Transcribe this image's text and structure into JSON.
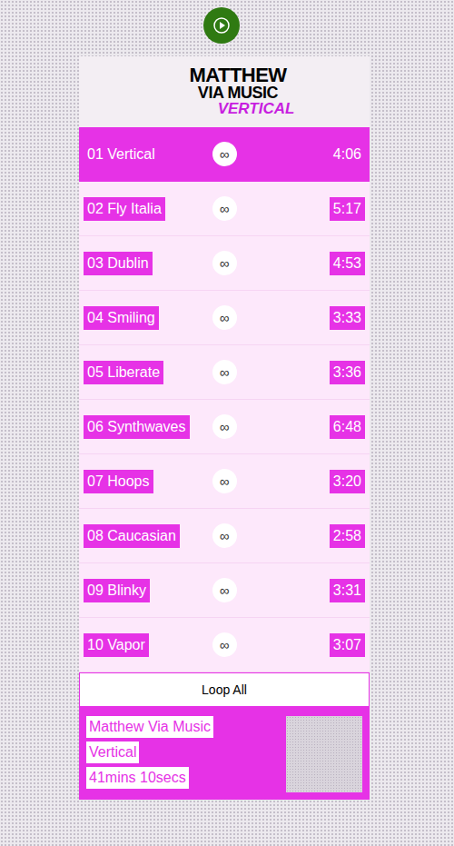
{
  "player": {
    "playing": false
  },
  "header": {
    "logo": [
      "MATTHEW",
      "VIA MUSIC",
      "VERTICAL"
    ]
  },
  "tracks": [
    {
      "title": "01 Vertical",
      "loop": "∞",
      "duration": "4:06",
      "selected": true
    },
    {
      "title": "02 Fly Italia",
      "loop": "∞",
      "duration": "5:17",
      "selected": false
    },
    {
      "title": "03 Dublin",
      "loop": "∞",
      "duration": "4:53",
      "selected": false
    },
    {
      "title": "04 Smiling",
      "loop": "∞",
      "duration": "3:33",
      "selected": false
    },
    {
      "title": "05 Liberate",
      "loop": "∞",
      "duration": "3:36",
      "selected": false
    },
    {
      "title": "06 Synthwaves",
      "loop": "∞",
      "duration": "6:48",
      "selected": false
    },
    {
      "title": "07 Hoops",
      "loop": "∞",
      "duration": "3:20",
      "selected": false
    },
    {
      "title": "08 Caucasian",
      "loop": "∞",
      "duration": "2:58",
      "selected": false
    },
    {
      "title": "09 Blinky",
      "loop": "∞",
      "duration": "3:31",
      "selected": false
    },
    {
      "title": "10 Vapor",
      "loop": "∞",
      "duration": "3:07",
      "selected": false
    }
  ],
  "loop_all": {
    "label": "Loop All"
  },
  "footer": {
    "artist": "Matthew Via Music",
    "album": "Vertical",
    "total": "41mins 10secs"
  }
}
